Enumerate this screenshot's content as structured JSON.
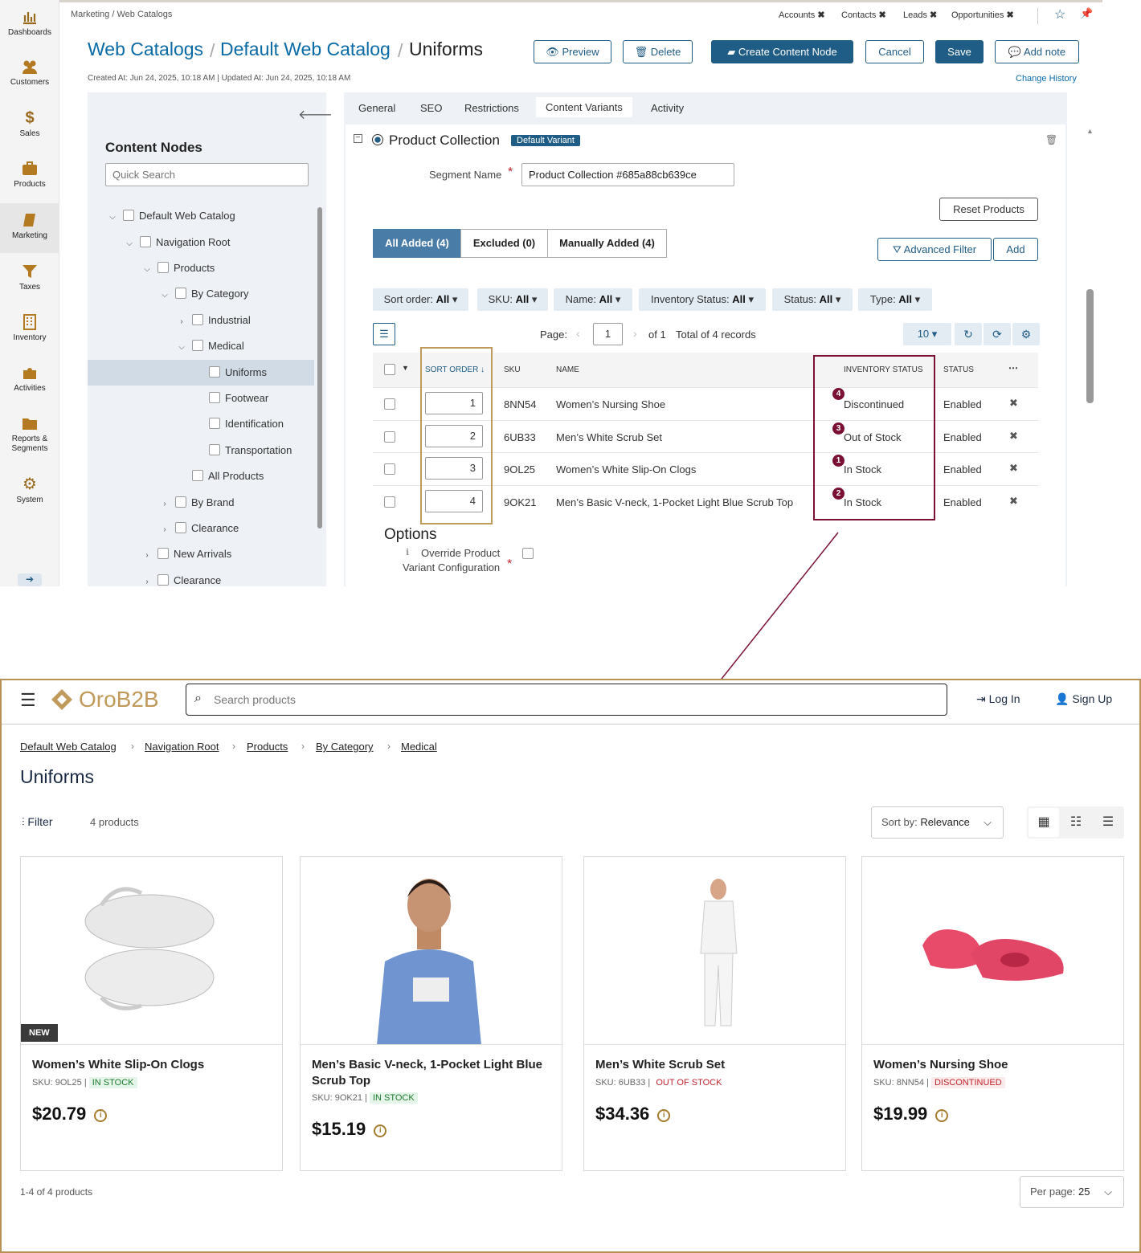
{
  "sidebar": {
    "items": [
      {
        "label": "Dashboards",
        "icon": "bar-chart-icon"
      },
      {
        "label": "Customers",
        "icon": "users-icon"
      },
      {
        "label": "Sales",
        "icon": "dollar-icon"
      },
      {
        "label": "Products",
        "icon": "briefcase-icon"
      },
      {
        "label": "Marketing",
        "icon": "book-icon"
      },
      {
        "label": "Taxes",
        "icon": "funnel-icon"
      },
      {
        "label": "Inventory",
        "icon": "building-icon"
      },
      {
        "label": "Activities",
        "icon": "puzzle-icon"
      },
      {
        "label": "Reports &",
        "label2": "Segments",
        "icon": "folder-icon"
      },
      {
        "label": "System",
        "icon": "gear-icon"
      }
    ]
  },
  "topbar": {
    "breadcrumb": "Marketing / Web Catalogs",
    "quick_links": [
      "Accounts",
      "Contacts",
      "Leads",
      "Opportunities"
    ]
  },
  "header": {
    "title_1": "Web Catalogs",
    "title_2": "Default Web Catalog",
    "title_3": "Uniforms",
    "meta": "Created At: Jun 24, 2025, 10:18 AM  |  Updated At: Jun 24, 2025, 10:18 AM",
    "buttons": {
      "preview": "Preview",
      "delete": "Delete",
      "create": "Create Content Node",
      "cancel": "Cancel",
      "save": "Save",
      "note": "Add note"
    },
    "change_history": "Change History"
  },
  "nodes": {
    "title": "Content Nodes",
    "search_placeholder": "Quick Search",
    "tree": [
      "Default Web Catalog",
      "Navigation Root",
      "Products",
      "By Category",
      "Industrial",
      "Medical",
      "Uniforms",
      "Footwear",
      "Identification",
      "Transportation",
      "All Products",
      "By Brand",
      "Clearance",
      "New Arrivals",
      "Clearance"
    ]
  },
  "tabs": [
    "General",
    "SEO",
    "Restrictions",
    "Content Variants",
    "Activity"
  ],
  "variant": {
    "title": "Product Collection",
    "badge": "Default Variant",
    "segment_label": "Segment Name",
    "segment_value": "Product Collection #685a88cb639ce",
    "views": [
      "All Added (4)",
      "Excluded (0)",
      "Manually Added (4)"
    ],
    "reset": "Reset Products",
    "adv_filter": "Advanced Filter",
    "add": "Add",
    "filters": [
      {
        "label": "Sort order:",
        "value": "All"
      },
      {
        "label": "SKU:",
        "value": "All"
      },
      {
        "label": "Name:",
        "value": "All"
      },
      {
        "label": "Inventory Status:",
        "value": "All"
      },
      {
        "label": "Status:",
        "value": "All"
      },
      {
        "label": "Type:",
        "value": "All"
      }
    ],
    "pager": {
      "page_label": "Page:",
      "page": "1",
      "of": "of 1",
      "total": "Total of 4 records",
      "per_page": "10"
    },
    "headers": {
      "sort": "SORT ORDER",
      "sku": "SKU",
      "name": "NAME",
      "inventory": "INVENTORY STATUS",
      "status": "STATUS"
    },
    "rows": [
      {
        "sort": "1",
        "sku": "8NN54",
        "name": "Women’s Nursing Shoe",
        "badge": "4",
        "inventory": "Discontinued",
        "status": "Enabled"
      },
      {
        "sort": "2",
        "sku": "6UB33",
        "name": "Men’s White Scrub Set",
        "badge": "3",
        "inventory": "Out of Stock",
        "status": "Enabled"
      },
      {
        "sort": "3",
        "sku": "9OL25",
        "name": "Women’s White Slip-On Clogs",
        "badge": "1",
        "inventory": "In Stock",
        "status": "Enabled"
      },
      {
        "sort": "4",
        "sku": "9OK21",
        "name": "Men’s Basic V-neck, 1-Pocket Light Blue Scrub Top",
        "badge": "2",
        "inventory": "In Stock",
        "status": "Enabled"
      }
    ],
    "options_title": "Options",
    "override_label_1": "Override Product",
    "override_label_2": "Variant Configuration"
  },
  "store": {
    "logo": "OroB2B",
    "search_placeholder": "Search products",
    "login": "Log In",
    "signup": "Sign Up",
    "breadcrumb": [
      "Default Web Catalog",
      "Navigation Root",
      "Products",
      "By Category",
      "Medical"
    ],
    "title": "Uniforms",
    "filter": "Filter",
    "count": "4 products",
    "sort_label": "Sort by:",
    "sort_value": "Relevance",
    "products": [
      {
        "name": "Women’s White Slip-On Clogs",
        "sku": "SKU: 9OL25 |",
        "stock": "IN STOCK",
        "stock_type": "in",
        "price": "$20.79",
        "tag": "NEW"
      },
      {
        "name": "Men’s Basic V-neck, 1-Pocket Light Blue Scrub Top",
        "sku": "SKU: 9OK21 |",
        "stock": "IN STOCK",
        "stock_type": "in",
        "price": "$15.19"
      },
      {
        "name": "Men’s White Scrub Set",
        "sku": "SKU: 6UB33 |",
        "stock": "OUT OF STOCK",
        "stock_type": "out",
        "price": "$34.36"
      },
      {
        "name": "Women’s Nursing Shoe",
        "sku": "SKU: 8NN54 |",
        "stock": "DISCONTINUED",
        "stock_type": "out",
        "price": "$19.99"
      }
    ],
    "range": "1-4 of 4 products",
    "per_page_label": "Per page:",
    "per_page": "25"
  },
  "colors": {
    "accent": "#1f5d86",
    "link": "#0a6aa6",
    "highlight_orange": "#c09a5b",
    "highlight_red": "#7a1033",
    "store_border": "#b69255"
  }
}
